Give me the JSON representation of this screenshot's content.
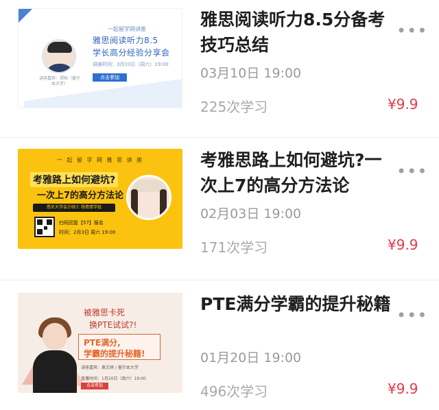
{
  "courses": [
    {
      "title": "雅思阅读听力8.5分备考技巧总结",
      "date": "03月10日 19:00",
      "learners": "225次学习",
      "price": "¥9.9",
      "more_icon": "more-dots-icon",
      "thumbnail": {
        "caption_top": "一起留学网讲座",
        "headline_line1": "雅思阅读听力8.5",
        "headline_line2": "学长高分经验分享会",
        "time_line": "讲座时间：3月10日（周六）19:00",
        "button": "点击参加",
        "speaker_line": "讲座嘉宾：郑昭（墨尔本大学）"
      }
    },
    {
      "title": "考雅思路上如何避坑?一次上7的高分方法论",
      "date": "02月03日 19:00",
      "learners": "171次学习",
      "price": "¥9.9",
      "more_icon": "more-dots-icon",
      "thumbnail": {
        "header": "一 起 留 学 网 雅 思 讲 座",
        "headline_line1": "考雅路上如何避坑?",
        "headline_line2": "一次上7的高分方法论",
        "bar_text": "悉尼大学会计硕士 杨倩倩学姐",
        "scan_line": "扫码回复【57】报名",
        "time_line": "时间：2月3日 周六 19:00"
      }
    },
    {
      "title": "PTE满分学霸的提升秘籍",
      "date": "01月20日 19:00",
      "learners": "496次学习",
      "price": "¥9.9",
      "more_icon": "more-dots-icon",
      "thumbnail": {
        "question_line1": "被雅思卡死",
        "question_line2": "换PTE试试?!",
        "box_line1": "PTE满分,",
        "box_line2": "学霸的提升秘籍!",
        "speaker_line": "讲座嘉宾：黄文婷 / 墨尔本大学",
        "time_line": "直播时间：1月20日（周六）19:00",
        "button": "点击参加"
      }
    }
  ],
  "colors": {
    "price": "#e8374a",
    "muted": "#9a9a9a",
    "title": "#1f1f1f",
    "thumb2_bg": "#fbc310",
    "thumb1_accent": "#2f6fcf"
  }
}
